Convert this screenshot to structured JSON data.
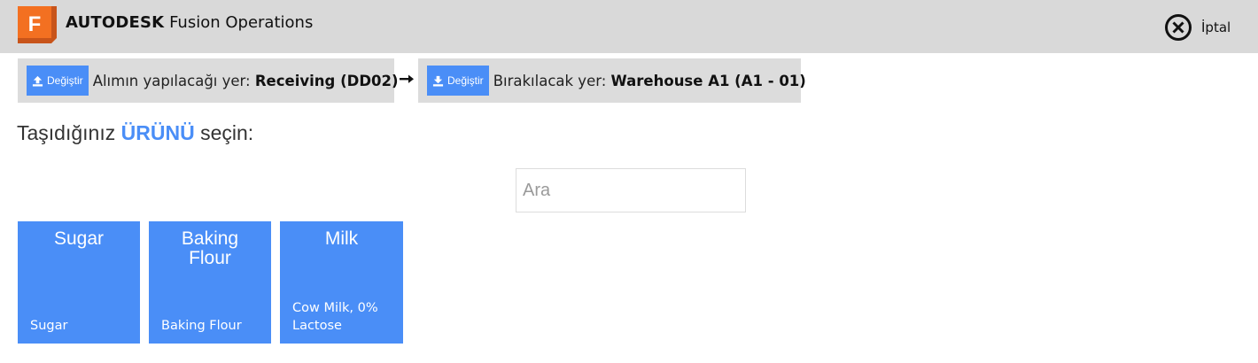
{
  "header": {
    "brand_bold": "AUTODESK",
    "brand_light": "Fusion Operations",
    "logo_letter": "F",
    "cancel_label": "İptal",
    "logo_icon": "autodesk-fusion-logo",
    "cancel_icon": "close-circle-icon"
  },
  "locations": {
    "pickup": {
      "button_label": "Değiştir",
      "button_icon": "upload-icon",
      "label": "Alımın yapılacağı yer: ",
      "value": "Receiving (DD02)"
    },
    "arrow_icon": "arrow-right-icon",
    "dropoff": {
      "button_label": "Değiştir",
      "button_icon": "download-icon",
      "label": "Bırakılacak yer: ",
      "value": "Warehouse A1 (A1 - 01)"
    }
  },
  "prompt": {
    "before": "Taşıdığınız ",
    "highlight": "ÜRÜNÜ",
    "after": " seçin:"
  },
  "search": {
    "placeholder": "Ara",
    "value": ""
  },
  "products": [
    {
      "name": "Sugar",
      "description": "Sugar"
    },
    {
      "name": "Baking Flour",
      "description": "Baking Flour"
    },
    {
      "name": "Milk",
      "description": "Cow Milk, 0% Lactose"
    }
  ],
  "colors": {
    "accent": "#4a8ef7",
    "topbar": "#d9d9d9",
    "location_bg": "#dcdcdc",
    "logo_orange": "#f37021"
  }
}
